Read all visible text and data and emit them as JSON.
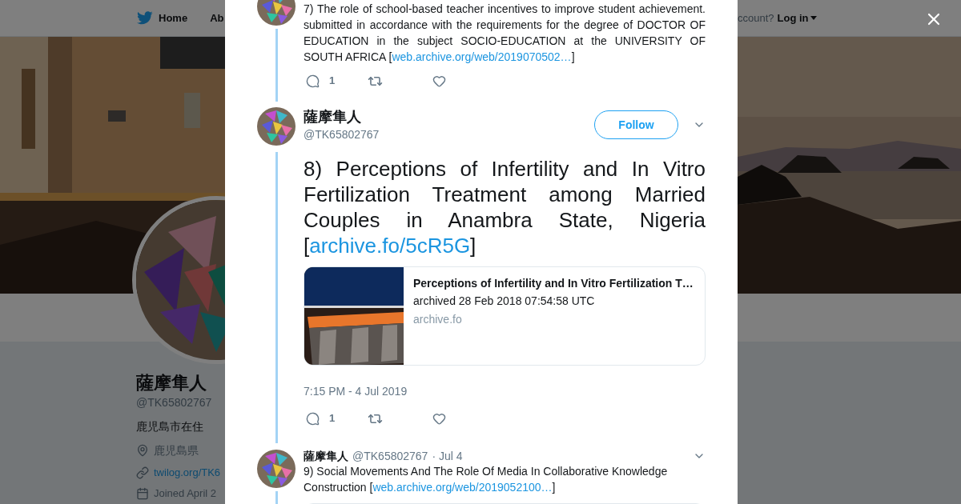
{
  "background_page": {
    "nav": {
      "items": [
        {
          "label": "Home",
          "kind": "home"
        },
        {
          "label": "Ab",
          "kind": "plain"
        }
      ],
      "account_prompt": "ccount?",
      "login": "Log in"
    },
    "profile": {
      "name": "薩摩隼人",
      "handle": "@TK65802767",
      "bio": "鹿児島市在住",
      "location": "鹿児島県",
      "website": "twilog.org/TK6",
      "joined": "Joined April 2"
    }
  },
  "modal": {
    "tweets": [
      {
        "kind": "continued",
        "text": "7) The role of school-based teacher incentives to improve student achievement. submitted in accordance with the requirements for the degree of DOCTOR OF EDUCATION in the subject SOCIO-EDUCATION at the UNIVERSITY OF SOUTH AFRICA [",
        "link": "web.archive.org/web/2019070502…",
        "text_after": "]",
        "reply_count": "1"
      },
      {
        "kind": "focused",
        "name": "薩摩隼人",
        "handle": "@TK65802767",
        "follow": "Follow",
        "text": "8) Perceptions of Infertility and In Vitro Fertilization Treatment among Married Couples in Anambra State, Nigeria [",
        "link": "archive.fo/5cR5G",
        "text_after": "]",
        "card": {
          "title": "Perceptions of Infertility and In Vitro Fertilization T…",
          "subtitle": "archived 28 Feb 2018 07:54:58 UTC",
          "domain": "archive.fo"
        },
        "timestamp": "7:15 PM - 4 Jul 2019",
        "reply_count": "1"
      },
      {
        "kind": "compact",
        "name": "薩摩隼人",
        "handle": "@TK65802767",
        "date": "· Jul 4",
        "text": "9) Social Movements And The Role Of Media In Collaborative Knowledge Construction [",
        "link": "web.archive.org/web/2019052100…",
        "text_after": "]"
      }
    ]
  }
}
